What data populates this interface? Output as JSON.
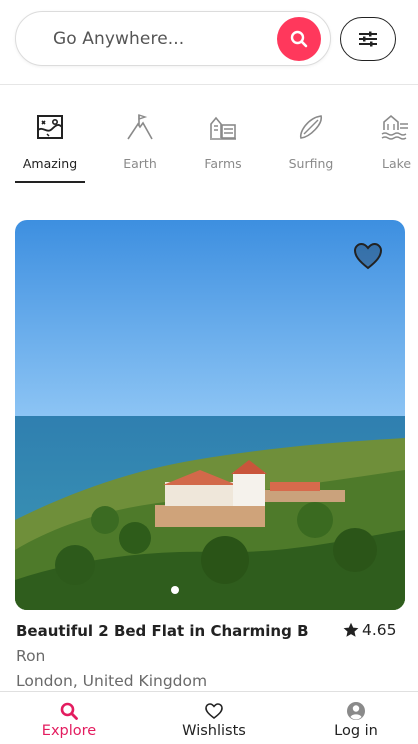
{
  "search": {
    "placeholder": "Go Anywhere..."
  },
  "categories": [
    {
      "label": "Amazing",
      "icon": "map-icon",
      "active": true
    },
    {
      "label": "Earth",
      "icon": "mountain-flag-icon",
      "active": false
    },
    {
      "label": "Farms",
      "icon": "farm-icon",
      "active": false
    },
    {
      "label": "Surfing",
      "icon": "surfboard-icon",
      "active": false
    },
    {
      "label": "Lake",
      "icon": "lake-icon",
      "active": false
    }
  ],
  "listing": {
    "title": "Beautiful 2 Bed Flat in Charming B",
    "rating": "4.65",
    "host": "Ron",
    "location": "London, United Kingdom",
    "image_dots": 1
  },
  "bottom_nav": [
    {
      "label": "Explore",
      "icon": "search-icon",
      "active": true
    },
    {
      "label": "Wishlists",
      "icon": "heart-icon",
      "active": false
    },
    {
      "label": "Log in",
      "icon": "user-circle-icon",
      "active": false
    }
  ],
  "colors": {
    "accent": "#ff385c",
    "active_nav": "#e31c5f",
    "text": "#222222",
    "muted": "#6a6a6a"
  }
}
